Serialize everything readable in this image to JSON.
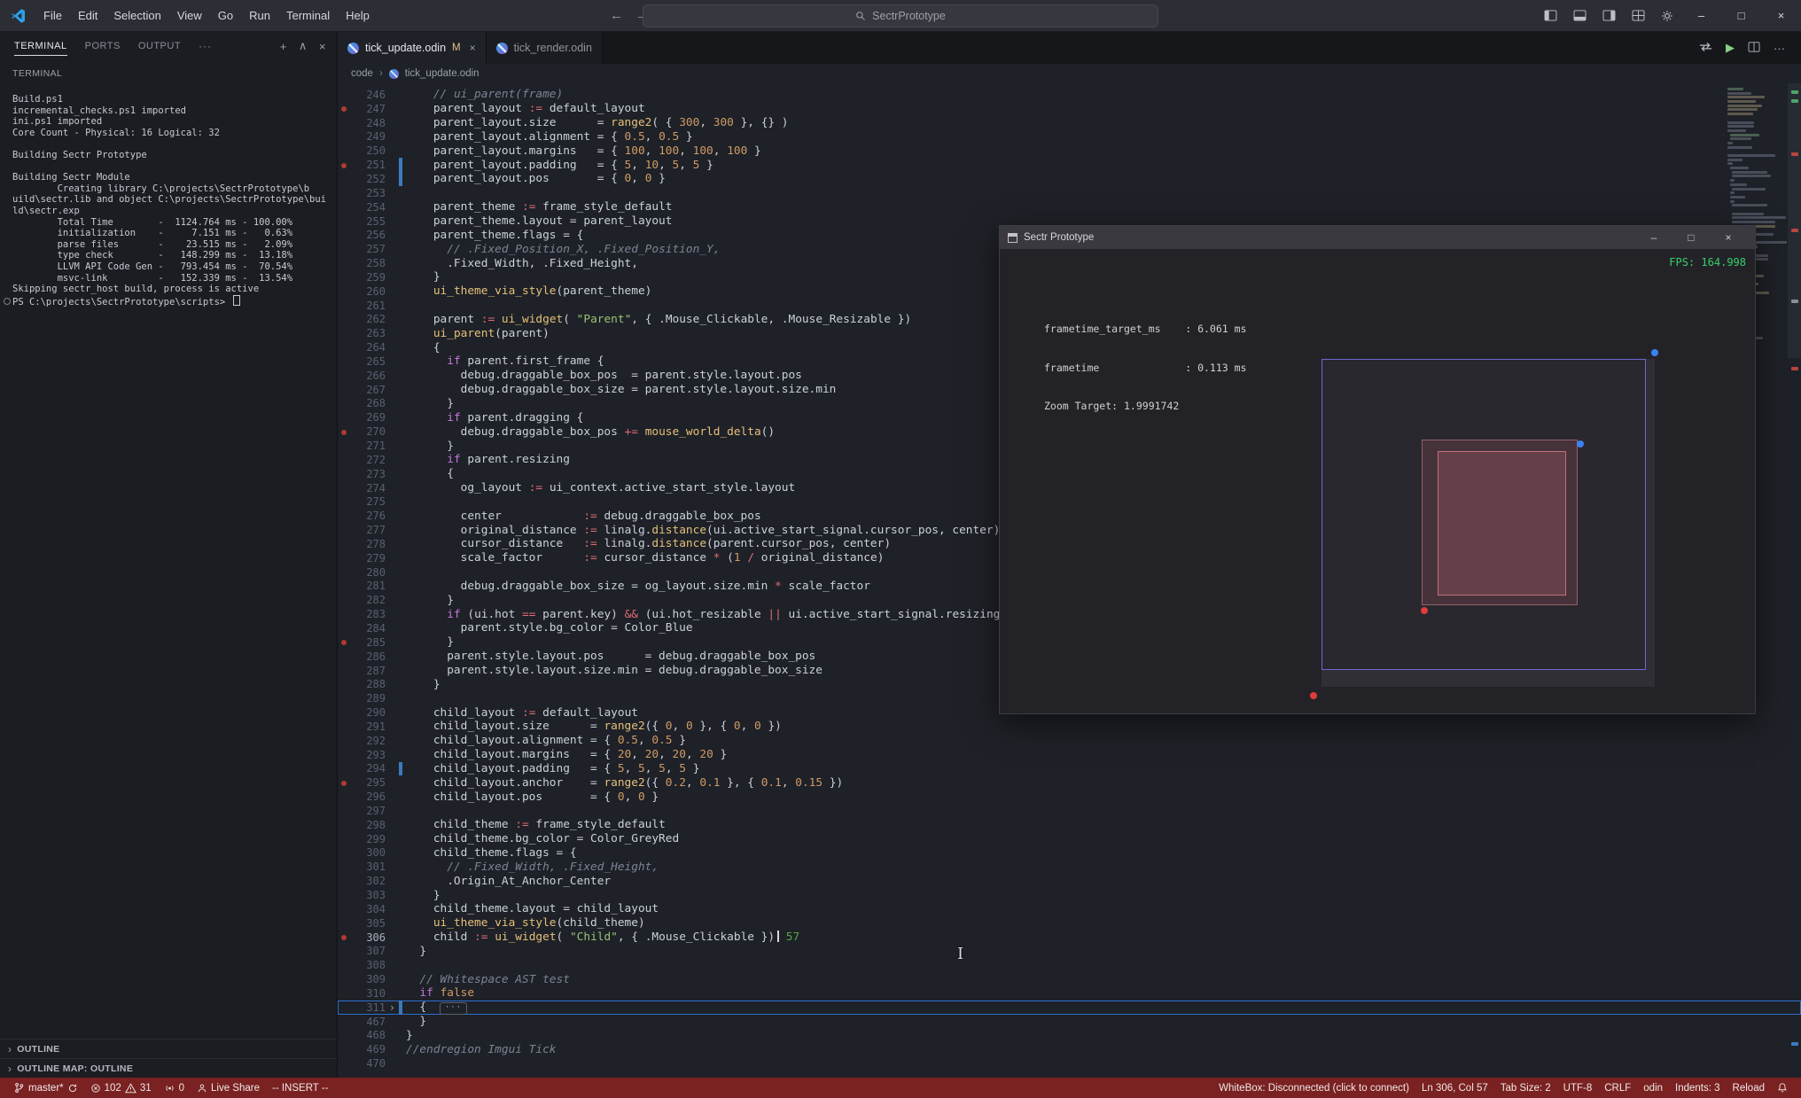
{
  "titlebar": {
    "menus": [
      "File",
      "Edit",
      "Selection",
      "View",
      "Go",
      "Run",
      "Terminal",
      "Help"
    ],
    "search": "SectrPrototype"
  },
  "panel": {
    "tabs": [
      "TERMINAL",
      "PORTS",
      "OUTPUT"
    ],
    "section_label": "TERMINAL",
    "terminal_lines": [
      "Build.ps1",
      "incremental_checks.ps1 imported",
      "ini.ps1 imported",
      "Core Count - Physical: 16 Logical: 32",
      "",
      "Building Sectr Prototype",
      "",
      "Building Sectr Module",
      "        Creating library C:\\projects\\SectrPrototype\\b",
      "uild\\sectr.lib and object C:\\projects\\SectrPrototype\\bui",
      "ld\\sectr.exp",
      "        Total Time        -  1124.764 ms - 100.00%",
      "        initialization    -     7.151 ms -   0.63%",
      "        parse files       -    23.515 ms -   2.09%",
      "        type check        -   148.299 ms -  13.18%",
      "        LLVM API Code Gen -   793.454 ms -  70.54%",
      "        msvc-link         -   152.339 ms -  13.54%",
      "Skipping sectr_host build, process is active",
      "PS C:\\projects\\SectrPrototype\\scripts> "
    ],
    "bottom_sections": [
      "OUTLINE",
      "OUTLINE MAP: OUTLINE"
    ]
  },
  "editor": {
    "tabs": [
      {
        "label": "tick_update.odin",
        "badge": "M",
        "active": true
      },
      {
        "label": "tick_render.odin",
        "badge": "",
        "active": false
      }
    ],
    "breadcrumb_root": "code",
    "breadcrumb_file": "tick_update.odin",
    "code_lines": [
      {
        "n": 246,
        "t": "    // ui_parent(frame)"
      },
      {
        "n": 247,
        "t": "    parent_layout := default_layout",
        "dot": true
      },
      {
        "n": 248,
        "t": "    parent_layout.size      = range2( { 300, 300 }, {} )"
      },
      {
        "n": 249,
        "t": "    parent_layout.alignment = { 0.5, 0.5 }"
      },
      {
        "n": 250,
        "t": "    parent_layout.margins   = { 100, 100, 100, 100 }"
      },
      {
        "n": 251,
        "t": "    parent_layout.padding   = { 5, 10, 5, 5 }",
        "dot": true,
        "bar": true
      },
      {
        "n": 252,
        "t": "    parent_layout.pos       = { 0, 0 }",
        "bar": true
      },
      {
        "n": 253,
        "t": ""
      },
      {
        "n": 254,
        "t": "    parent_theme := frame_style_default"
      },
      {
        "n": 255,
        "t": "    parent_theme.layout = parent_layout"
      },
      {
        "n": 256,
        "t": "    parent_theme.flags = {"
      },
      {
        "n": 257,
        "t": "      // .Fixed_Position_X, .Fixed_Position_Y,"
      },
      {
        "n": 258,
        "t": "      .Fixed_Width, .Fixed_Height,"
      },
      {
        "n": 259,
        "t": "    }"
      },
      {
        "n": 260,
        "t": "    ui_theme_via_style(parent_theme)"
      },
      {
        "n": 261,
        "t": ""
      },
      {
        "n": 262,
        "t": "    parent := ui_widget( \"Parent\", { .Mouse_Clickable, .Mouse_Resizable })"
      },
      {
        "n": 263,
        "t": "    ui_parent(parent)"
      },
      {
        "n": 264,
        "t": "    {"
      },
      {
        "n": 265,
        "t": "      if parent.first_frame {"
      },
      {
        "n": 266,
        "t": "        debug.draggable_box_pos  = parent.style.layout.pos"
      },
      {
        "n": 267,
        "t": "        debug.draggable_box_size = parent.style.layout.size.min"
      },
      {
        "n": 268,
        "t": "      }"
      },
      {
        "n": 269,
        "t": "      if parent.dragging {"
      },
      {
        "n": 270,
        "t": "        debug.draggable_box_pos += mouse_world_delta()",
        "dot": true
      },
      {
        "n": 271,
        "t": "      }"
      },
      {
        "n": 272,
        "t": "      if parent.resizing"
      },
      {
        "n": 273,
        "t": "      {"
      },
      {
        "n": 274,
        "t": "        og_layout := ui_context.active_start_style.layout"
      },
      {
        "n": 275,
        "t": ""
      },
      {
        "n": 276,
        "t": "        center            := debug.draggable_box_pos"
      },
      {
        "n": 277,
        "t": "        original_distance := linalg.distance(ui.active_start_signal.cursor_pos, center)"
      },
      {
        "n": 278,
        "t": "        cursor_distance   := linalg.distance(parent.cursor_pos, center)"
      },
      {
        "n": 279,
        "t": "        scale_factor      := cursor_distance * (1 / original_distance)"
      },
      {
        "n": 280,
        "t": ""
      },
      {
        "n": 281,
        "t": "        debug.draggable_box_size = og_layout.size.min * scale_factor"
      },
      {
        "n": 282,
        "t": "      }"
      },
      {
        "n": 283,
        "t": "      if (ui.hot == parent.key) && (ui.hot_resizable || ui.active_start_signal.resizing) {"
      },
      {
        "n": 284,
        "t": "        parent.style.bg_color = Color_Blue"
      },
      {
        "n": 285,
        "t": "      }",
        "dot": true
      },
      {
        "n": 286,
        "t": "      parent.style.layout.pos      = debug.draggable_box_pos"
      },
      {
        "n": 287,
        "t": "      parent.style.layout.size.min = debug.draggable_box_size"
      },
      {
        "n": 288,
        "t": "    }"
      },
      {
        "n": 289,
        "t": ""
      },
      {
        "n": 290,
        "t": "    child_layout := default_layout"
      },
      {
        "n": 291,
        "t": "    child_layout.size      = range2({ 0, 0 }, { 0, 0 })"
      },
      {
        "n": 292,
        "t": "    child_layout.alignment = { 0.5, 0.5 }"
      },
      {
        "n": 293,
        "t": "    child_layout.margins   = { 20, 20, 20, 20 }"
      },
      {
        "n": 294,
        "t": "    child_layout.padding   = { 5, 5, 5, 5 }",
        "bar": true
      },
      {
        "n": 295,
        "t": "    child_layout.anchor    = range2({ 0.2, 0.1 }, { 0.1, 0.15 })",
        "dot": true
      },
      {
        "n": 296,
        "t": "    child_layout.pos       = { 0, 0 }"
      },
      {
        "n": 297,
        "t": ""
      },
      {
        "n": 298,
        "t": "    child_theme := frame_style_default"
      },
      {
        "n": 299,
        "t": "    child_theme.bg_color = Color_GreyRed"
      },
      {
        "n": 300,
        "t": "    child_theme.flags = {"
      },
      {
        "n": 301,
        "t": "      // .Fixed_Width, .Fixed_Height,"
      },
      {
        "n": 302,
        "t": "      .Origin_At_Anchor_Center"
      },
      {
        "n": 303,
        "t": "    }"
      },
      {
        "n": 304,
        "t": "    child_theme.layout = child_layout"
      },
      {
        "n": 305,
        "t": "    ui_theme_via_style(child_theme)"
      },
      {
        "n": 306,
        "t": "    child := ui_widget( \"Child\", { .Mouse_Clickable })",
        "dot": true,
        "cur": true,
        "hint": "57"
      },
      {
        "n": 307,
        "t": "  }"
      },
      {
        "n": 308,
        "t": ""
      },
      {
        "n": 309,
        "t": "  // Whitespace AST test"
      },
      {
        "n": 310,
        "t": "  if false"
      },
      {
        "n": 311,
        "t": "  {",
        "fold": true,
        "outline": true,
        "bar": true
      },
      {
        "n": 467,
        "t": "  }"
      },
      {
        "n": 468,
        "t": "}"
      },
      {
        "n": 469,
        "t": "//endregion Imgui Tick"
      },
      {
        "n": 470,
        "t": ""
      }
    ]
  },
  "overlay": {
    "title": "Sectr Prototype",
    "fps": "FPS: 164.998",
    "stats": [
      "frametime_target_ms    : 6.061 ms",
      "frametime              : 0.113 ms",
      "Zoom Target: 1.9991742"
    ]
  },
  "statusbar": {
    "branch": "master*",
    "errors": "102",
    "warnings": "31",
    "broadcast": "0",
    "live_share": "Live Share",
    "mode": "-- INSERT --",
    "whitebox": "WhiteBox: Disconnected (click to connect)",
    "position": "Ln 306, Col 57",
    "tab_size": "Tab Size: 2",
    "encoding": "UTF-8",
    "eol": "CRLF",
    "language": "odin",
    "indents": "Indents: 3",
    "reload": "Reload"
  },
  "colors": {
    "statusbar_bg": "#7a2121",
    "fps_green": "#35d06a",
    "git_modified_blue": "#3a7bbf",
    "parent_box_border": "#6d68cf",
    "child_box_border": "#c4707f",
    "string_green": "#98c379",
    "keyword_purple": "#c678dd",
    "number_orange": "#d19a66",
    "function_gold": "#e5c07b",
    "point_blue": "#3b82f6",
    "point_red": "#e23b3b"
  }
}
